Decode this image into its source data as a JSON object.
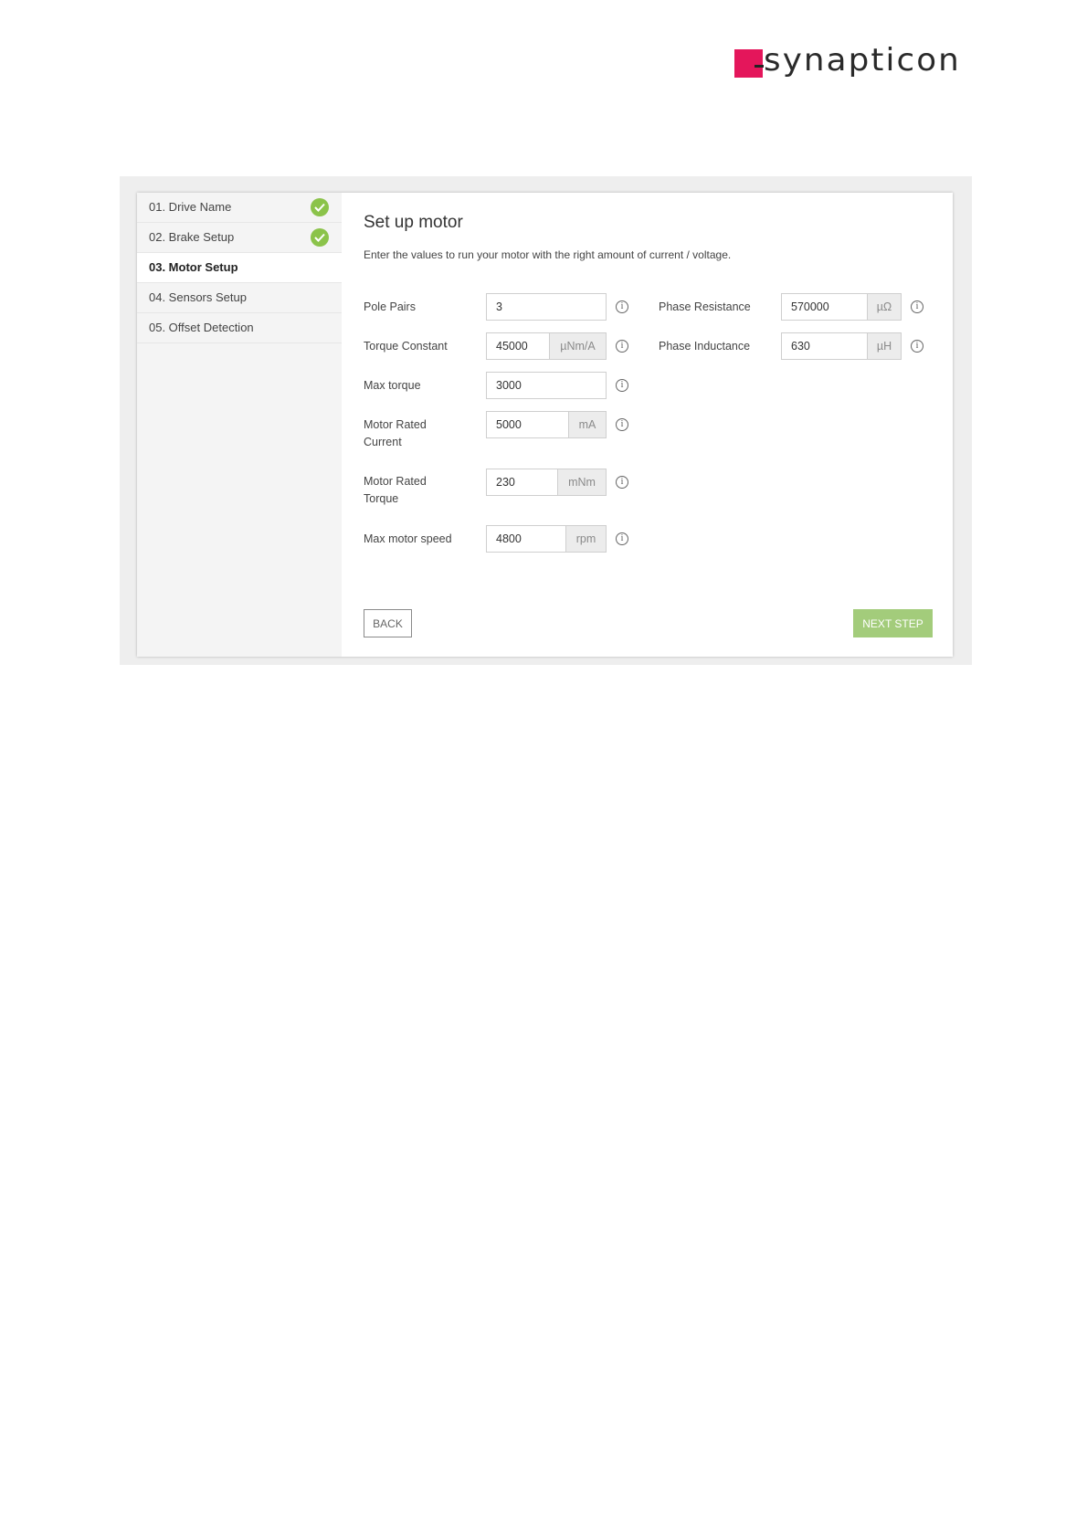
{
  "logo": {
    "text": "synapticon",
    "color": "#e4165b"
  },
  "steps": [
    {
      "label": "01. Drive Name",
      "done": true
    },
    {
      "label": "02. Brake Setup",
      "done": true
    },
    {
      "label": "03. Motor Setup",
      "done": false,
      "active": true
    },
    {
      "label": "04. Sensors Setup",
      "done": false
    },
    {
      "label": "05. Offset Detection",
      "done": false
    }
  ],
  "main": {
    "title": "Set up motor",
    "subtitle": "Enter the values to run your motor with the right amount of current / voltage."
  },
  "fields": {
    "pole_pairs": {
      "label": "Pole Pairs",
      "value": "3",
      "unit": ""
    },
    "torque_constant": {
      "label": "Torque Constant",
      "value": "45000",
      "unit": "µNm/A"
    },
    "max_torque": {
      "label": "Max torque",
      "value": "3000",
      "unit": ""
    },
    "motor_rated_current": {
      "label": "Motor Rated Current",
      "value": "5000",
      "unit": "mA"
    },
    "motor_rated_torque": {
      "label": "Motor Rated Torque",
      "value": "230",
      "unit": "mNm"
    },
    "max_motor_speed": {
      "label": "Max motor speed",
      "value": "4800",
      "unit": "rpm"
    },
    "phase_resistance": {
      "label": "Phase Resistance",
      "value": "570000",
      "unit": "µΩ"
    },
    "phase_inductance": {
      "label": "Phase Inductance",
      "value": "630",
      "unit": "µH"
    }
  },
  "info_icon_glyph": "i",
  "buttons": {
    "back": "BACK",
    "next": "NEXT STEP"
  },
  "colors": {
    "accent_green": "#8bc34a",
    "next_button": "#a3cc7b"
  }
}
